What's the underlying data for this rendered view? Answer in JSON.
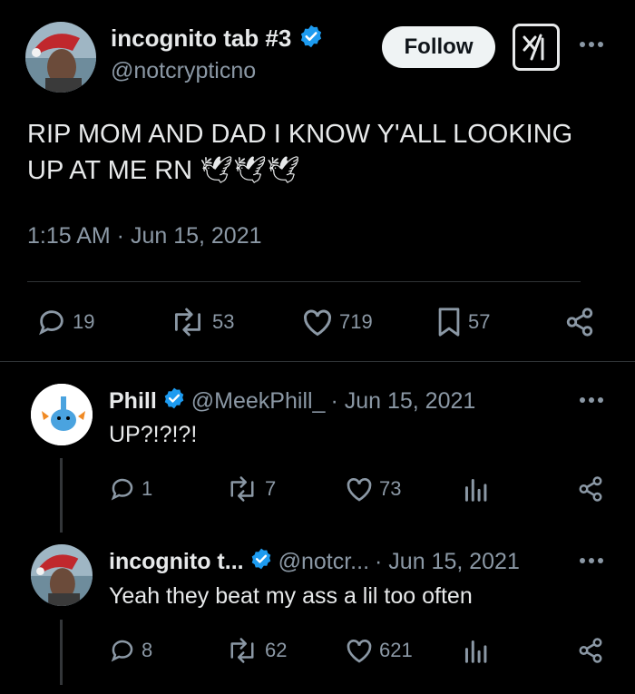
{
  "main_tweet": {
    "author_name": "incognito tab #3",
    "author_handle": "@notcrypticno",
    "follow_label": "Follow",
    "text": "RIP MOM AND DAD I KNOW Y'ALL LOOKING UP AT ME RN 🕊🕊🕊",
    "timestamp": "1:15 AM · Jun 15, 2021",
    "stats": {
      "replies": "19",
      "retweets": "53",
      "likes": "719",
      "bookmarks": "57"
    }
  },
  "replies": [
    {
      "author_name": "Phill",
      "author_handle": "@MeekPhill_",
      "date": "· Jun 15, 2021",
      "text": "UP?!?!?!",
      "stats": {
        "replies": "1",
        "retweets": "7",
        "likes": "73"
      }
    },
    {
      "author_name": "incognito t...",
      "author_handle": "@notcr...",
      "date": "· Jun 15, 2021",
      "text": "Yeah they beat my ass a lil too often",
      "stats": {
        "replies": "8",
        "retweets": "62",
        "likes": "621"
      }
    }
  ],
  "colors": {
    "background": "#000000",
    "text": "#e7e9ea",
    "secondary": "#8b98a5",
    "verified": "#1d9bf0",
    "divider": "#2f3336"
  }
}
